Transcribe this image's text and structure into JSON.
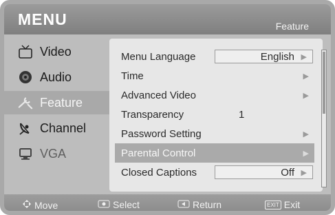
{
  "header": {
    "title": "MENU",
    "section": "Feature"
  },
  "sidebar": {
    "items": [
      {
        "label": "Video",
        "icon": "tv-icon"
      },
      {
        "label": "Audio",
        "icon": "speaker-icon"
      },
      {
        "label": "Feature",
        "icon": "wrench-icon"
      },
      {
        "label": "Channel",
        "icon": "satellite-icon"
      },
      {
        "label": "VGA",
        "icon": "monitor-icon"
      }
    ]
  },
  "feature_panel": {
    "rows": [
      {
        "label": "Menu Language",
        "value": "English"
      },
      {
        "label": "Time"
      },
      {
        "label": "Advanced Video"
      },
      {
        "label": "Transparency",
        "value": "1"
      },
      {
        "label": "Password Setting"
      },
      {
        "label": "Parental Control"
      },
      {
        "label": "Closed Captions",
        "value": "Off"
      }
    ],
    "arrow_glyph": "▶"
  },
  "footer": {
    "move": "Move",
    "select": "Select",
    "return": "Return",
    "exit_key": "EXIT",
    "exit": "Exit"
  },
  "colors": {
    "background": "#bdbdbd",
    "panel": "#e7e7e7",
    "highlight": "#aaaaaa",
    "header": "#8a8a8a"
  }
}
